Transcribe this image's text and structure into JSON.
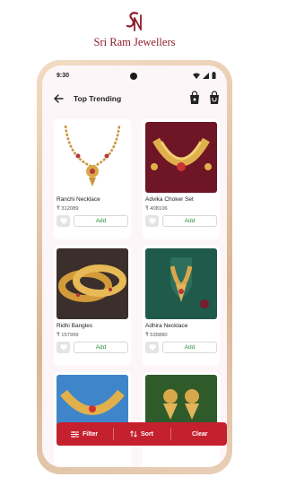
{
  "brand": {
    "name": "Sri Ram Jewellers",
    "color": "#8e1b2b"
  },
  "status_bar": {
    "time": "9:30",
    "icons": [
      "wifi-icon",
      "signal-icon",
      "battery-icon"
    ]
  },
  "app_bar": {
    "title": "Top Trending",
    "back_icon": "arrow-left-icon",
    "actions": [
      "shopping-bag-icon",
      "shopping-bag-icon"
    ]
  },
  "products": [
    {
      "name": "Ranchi Necklace",
      "price": "₹ 312089",
      "add_label": "Add",
      "image": "gold-necklace-on-white"
    },
    {
      "name": "Advika Choker Set",
      "price": "₹ 408106",
      "add_label": "Add",
      "image": "gold-choker-on-maroon"
    },
    {
      "name": "Ridhi Bangles",
      "price": "₹ 157999",
      "add_label": "Add",
      "image": "gold-bangles-on-dark"
    },
    {
      "name": "Adhira Necklace",
      "price": "₹ 535880",
      "add_label": "Add",
      "image": "gold-necklace-on-green"
    },
    {
      "name": "",
      "price": "",
      "add_label": "",
      "image": "gold-choker-on-blue"
    },
    {
      "name": "",
      "price": "",
      "add_label": "",
      "image": "gold-earrings-on-leaf"
    }
  ],
  "bottom_bar": {
    "filter_label": "Filter",
    "sort_label": "Sort",
    "clear_label": "Clear",
    "color": "#c5202e"
  },
  "colors": {
    "accent": "#c5202e",
    "add_text": "#2e8b3d",
    "background": "#fdf6f8"
  }
}
